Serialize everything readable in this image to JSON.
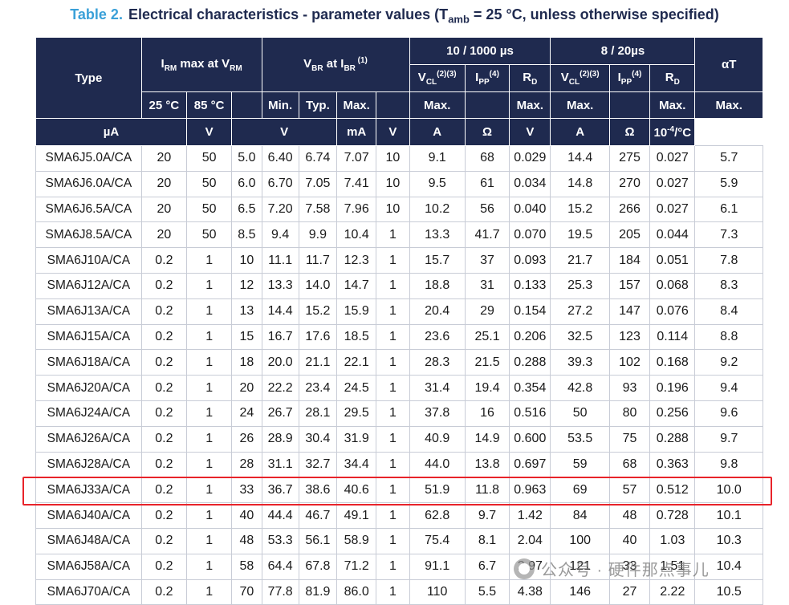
{
  "title": {
    "table_num": "Table 2.",
    "text_a": "Electrical characteristics - parameter values (T",
    "sub": "amb",
    "text_b": " = 25 °C, unless otherwise specified)"
  },
  "header": {
    "type": "Type",
    "irm": {
      "a": "I",
      "a_sub": "RM",
      "b": " max at V",
      "b_sub": "RM"
    },
    "vbr": {
      "a": "V",
      "a_sub": "BR",
      "b": " at I",
      "b_sub": "BR",
      "sup": " (1)"
    },
    "group_10_1000": "10 / 1000 µs",
    "group_8_20": "8 / 20µs",
    "alphat": "αT",
    "vcl": {
      "a": "V",
      "sub": "CL",
      "sup": "(2)(3)"
    },
    "ipp": {
      "a": "I",
      "sub": "PP",
      "sup": "(4)"
    },
    "rd": {
      "a": "R",
      "sub": "D"
    },
    "t25": "25 °C",
    "t85": "85 °C",
    "min": "Min.",
    "typ": "Typ.",
    "max": "Max.",
    "units": [
      "µA",
      "V",
      "V",
      "mA",
      "V",
      "A",
      "Ω",
      "V",
      "A",
      "Ω"
    ],
    "unit_alphat": {
      "a": "10",
      "sup": "-4",
      "b": "/°C"
    }
  },
  "rows": [
    [
      "SMA6J5.0A/CA",
      "20",
      "50",
      "5.0",
      "6.40",
      "6.74",
      "7.07",
      "10",
      "9.1",
      "68",
      "0.029",
      "14.4",
      "275",
      "0.027",
      "5.7"
    ],
    [
      "SMA6J6.0A/CA",
      "20",
      "50",
      "6.0",
      "6.70",
      "7.05",
      "7.41",
      "10",
      "9.5",
      "61",
      "0.034",
      "14.8",
      "270",
      "0.027",
      "5.9"
    ],
    [
      "SMA6J6.5A/CA",
      "20",
      "50",
      "6.5",
      "7.20",
      "7.58",
      "7.96",
      "10",
      "10.2",
      "56",
      "0.040",
      "15.2",
      "266",
      "0.027",
      "6.1"
    ],
    [
      "SMA6J8.5A/CA",
      "20",
      "50",
      "8.5",
      "9.4",
      "9.9",
      "10.4",
      "1",
      "13.3",
      "41.7",
      "0.070",
      "19.5",
      "205",
      "0.044",
      "7.3"
    ],
    [
      "SMA6J10A/CA",
      "0.2",
      "1",
      "10",
      "11.1",
      "11.7",
      "12.3",
      "1",
      "15.7",
      "37",
      "0.093",
      "21.7",
      "184",
      "0.051",
      "7.8"
    ],
    [
      "SMA6J12A/CA",
      "0.2",
      "1",
      "12",
      "13.3",
      "14.0",
      "14.7",
      "1",
      "18.8",
      "31",
      "0.133",
      "25.3",
      "157",
      "0.068",
      "8.3"
    ],
    [
      "SMA6J13A/CA",
      "0.2",
      "1",
      "13",
      "14.4",
      "15.2",
      "15.9",
      "1",
      "20.4",
      "29",
      "0.154",
      "27.2",
      "147",
      "0.076",
      "8.4"
    ],
    [
      "SMA6J15A/CA",
      "0.2",
      "1",
      "15",
      "16.7",
      "17.6",
      "18.5",
      "1",
      "23.6",
      "25.1",
      "0.206",
      "32.5",
      "123",
      "0.114",
      "8.8"
    ],
    [
      "SMA6J18A/CA",
      "0.2",
      "1",
      "18",
      "20.0",
      "21.1",
      "22.1",
      "1",
      "28.3",
      "21.5",
      "0.288",
      "39.3",
      "102",
      "0.168",
      "9.2"
    ],
    [
      "SMA6J20A/CA",
      "0.2",
      "1",
      "20",
      "22.2",
      "23.4",
      "24.5",
      "1",
      "31.4",
      "19.4",
      "0.354",
      "42.8",
      "93",
      "0.196",
      "9.4"
    ],
    [
      "SMA6J24A/CA",
      "0.2",
      "1",
      "24",
      "26.7",
      "28.1",
      "29.5",
      "1",
      "37.8",
      "16",
      "0.516",
      "50",
      "80",
      "0.256",
      "9.6"
    ],
    [
      "SMA6J26A/CA",
      "0.2",
      "1",
      "26",
      "28.9",
      "30.4",
      "31.9",
      "1",
      "40.9",
      "14.9",
      "0.600",
      "53.5",
      "75",
      "0.288",
      "9.7"
    ],
    [
      "SMA6J28A/CA",
      "0.2",
      "1",
      "28",
      "31.1",
      "32.7",
      "34.4",
      "1",
      "44.0",
      "13.8",
      "0.697",
      "59",
      "68",
      "0.363",
      "9.8"
    ],
    [
      "SMA6J33A/CA",
      "0.2",
      "1",
      "33",
      "36.7",
      "38.6",
      "40.6",
      "1",
      "51.9",
      "11.8",
      "0.963",
      "69",
      "57",
      "0.512",
      "10.0"
    ],
    [
      "SMA6J40A/CA",
      "0.2",
      "1",
      "40",
      "44.4",
      "46.7",
      "49.1",
      "1",
      "62.8",
      "9.7",
      "1.42",
      "84",
      "48",
      "0.728",
      "10.1"
    ],
    [
      "SMA6J48A/CA",
      "0.2",
      "1",
      "48",
      "53.3",
      "56.1",
      "58.9",
      "1",
      "75.4",
      "8.1",
      "2.04",
      "100",
      "40",
      "1.03",
      "10.3"
    ],
    [
      "SMA6J58A/CA",
      "0.2",
      "1",
      "58",
      "64.4",
      "67.8",
      "71.2",
      "1",
      "91.1",
      "6.7",
      "2.97",
      "121",
      "33",
      "1.51",
      "10.4"
    ],
    [
      "SMA6J70A/CA",
      "0.2",
      "1",
      "70",
      "77.8",
      "81.9",
      "86.0",
      "1",
      "110",
      "5.5",
      "4.38",
      "146",
      "27",
      "2.22",
      "10.5"
    ]
  ],
  "highlighted_row": "SMA6J33A/CA",
  "highlight_color": "#e8232a",
  "header_color": "#1f2a4f",
  "watermark": "公众号 · 硬件那点事儿"
}
